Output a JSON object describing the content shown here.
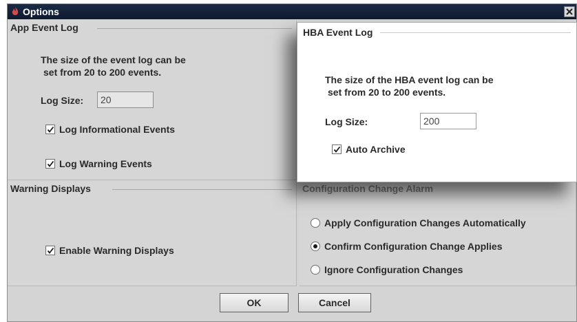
{
  "window": {
    "title": "Options"
  },
  "app_event_log": {
    "legend": "App Event Log",
    "desc_line1": "The size of the event log can be",
    "desc_line2": "set from 20 to 200 events.",
    "log_size_label": "Log Size:",
    "log_size_value": "20",
    "log_informational": {
      "label": "Log Informational Events",
      "checked": true
    },
    "log_warning": {
      "label": "Log Warning Events",
      "checked": true
    }
  },
  "hba_event_log": {
    "legend": "HBA Event Log",
    "desc_line1": "The size of the HBA event log can be",
    "desc_line2": "set from 20 to 200 events.",
    "log_size_label": "Log Size:",
    "log_size_value": "200",
    "auto_archive": {
      "label": "Auto Archive",
      "checked": true
    }
  },
  "warning_displays": {
    "legend": "Warning Displays",
    "enable": {
      "label": "Enable Warning Displays",
      "checked": true
    }
  },
  "config_change_alarm": {
    "legend": "Configuration Change Alarm",
    "options": [
      {
        "label": "Apply Configuration Changes Automatically",
        "selected": false
      },
      {
        "label": "Confirm Configuration Change Applies",
        "selected": true
      },
      {
        "label": "Ignore Configuration Changes",
        "selected": false
      }
    ]
  },
  "buttons": {
    "ok": "OK",
    "cancel": "Cancel"
  }
}
